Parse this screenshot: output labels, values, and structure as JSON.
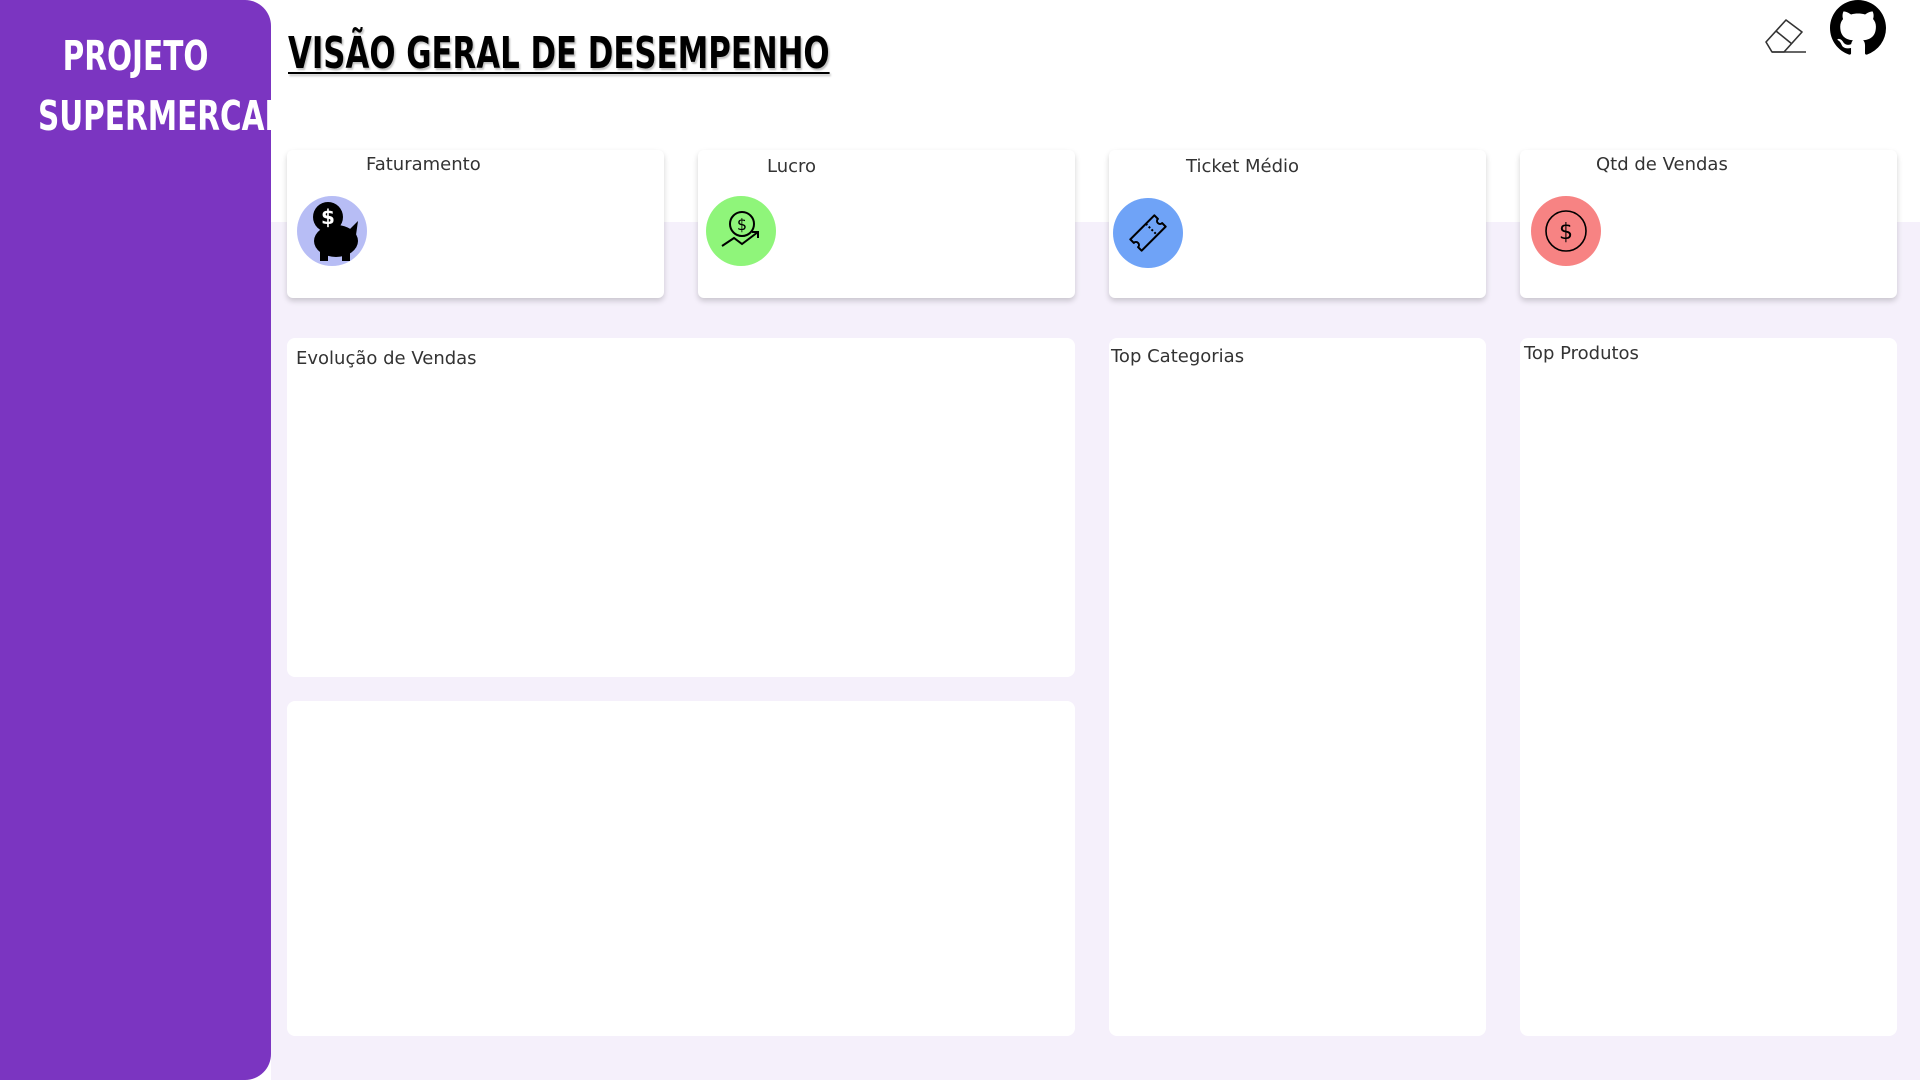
{
  "sidebar": {
    "brand_line1": "PROJETO",
    "brand_line2": "SUPERMERCADO",
    "bg_color": "#7b35c1"
  },
  "header": {
    "title": "VISÃO GERAL DE DESEMPENHO",
    "icons": [
      "eraser-icon",
      "github-icon"
    ]
  },
  "kpis": [
    {
      "label": "Faturamento",
      "icon": "piggy-bank-icon",
      "color": "#b7bdf5"
    },
    {
      "label": "Lucro",
      "icon": "money-growth-icon",
      "color": "#8ff57a"
    },
    {
      "label": "Ticket Médio",
      "icon": "ticket-icon",
      "color": "#6fa3f7"
    },
    {
      "label": "Qtd de Vendas",
      "icon": "dollar-coin-icon",
      "color": "#f78383"
    }
  ],
  "panels": {
    "sales_evolution": {
      "title": "Evolução de Vendas"
    },
    "top_categories": {
      "title": "Top Categorias"
    },
    "top_products": {
      "title": "Top Produtos"
    }
  }
}
